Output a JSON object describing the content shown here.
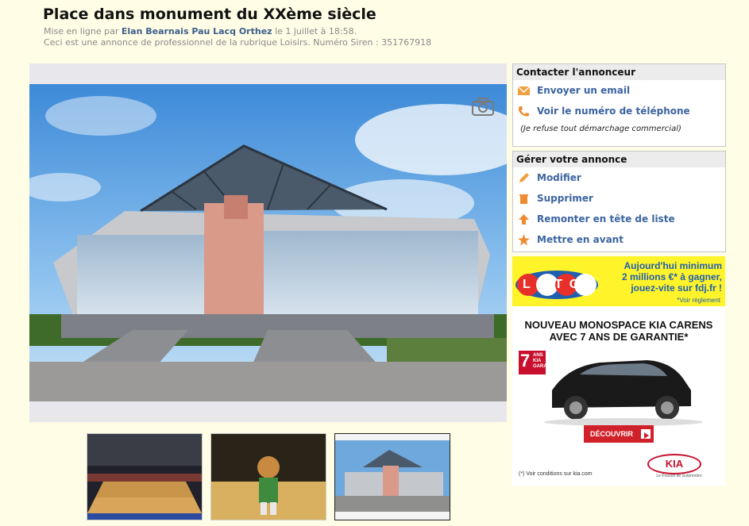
{
  "ad": {
    "title": "Place dans monument du XXème siècle",
    "posted_prefix": "Mise en ligne par",
    "advertiser": "Elan Bearnais Pau Lacq Orthez",
    "posted_date": "le 1 juillet à 18:58.",
    "pro_notice": "Ceci est une annonce de professionnel de la rubrique Loisirs. Numéro Siren : 351767918"
  },
  "contact": {
    "heading": "Contacter l'annonceur",
    "email_label": "Envoyer un email",
    "phone_label": "Voir le numéro de téléphone",
    "note": "(Je refuse tout démarchage commercial)"
  },
  "manage": {
    "heading": "Gérer votre annonce",
    "items": [
      {
        "label": "Modifier",
        "icon": "pencil-icon"
      },
      {
        "label": "Supprimer",
        "icon": "trash-icon"
      },
      {
        "label": "Remonter en tête de liste",
        "icon": "arrow-up-icon"
      },
      {
        "label": "Mettre en avant",
        "icon": "star-icon"
      }
    ]
  },
  "loto_ad": {
    "logo": "LOTO",
    "line1": "Aujourd'hui minimum",
    "line2": "2 millions €* à gagner,",
    "line3": "jouez-vite sur fdj.fr !",
    "footnote": "*Voir règlement",
    "bg_color": "#fff32a"
  },
  "kia_ad": {
    "headline1": "NOUVEAU MONOSPACE KIA CARENS",
    "headline2": "AVEC 7 ANS DE GARANTIE*",
    "badge": "7",
    "badge_sub1": "ANS",
    "badge_sub2": "KIA",
    "badge_sub3": "GARANTIE",
    "cta": "DÉCOUVRIR",
    "disclaimer": "(*) Voir conditions sur kia.com",
    "logo": "KIA",
    "tagline": "Le Pouvoir de Surprendre",
    "cta_color": "#d0202a"
  },
  "gallery": {
    "thumbnails": [
      "basketball-arena-thumb",
      "mascot-thumb",
      "building-thumb"
    ],
    "selected_index": 2
  }
}
